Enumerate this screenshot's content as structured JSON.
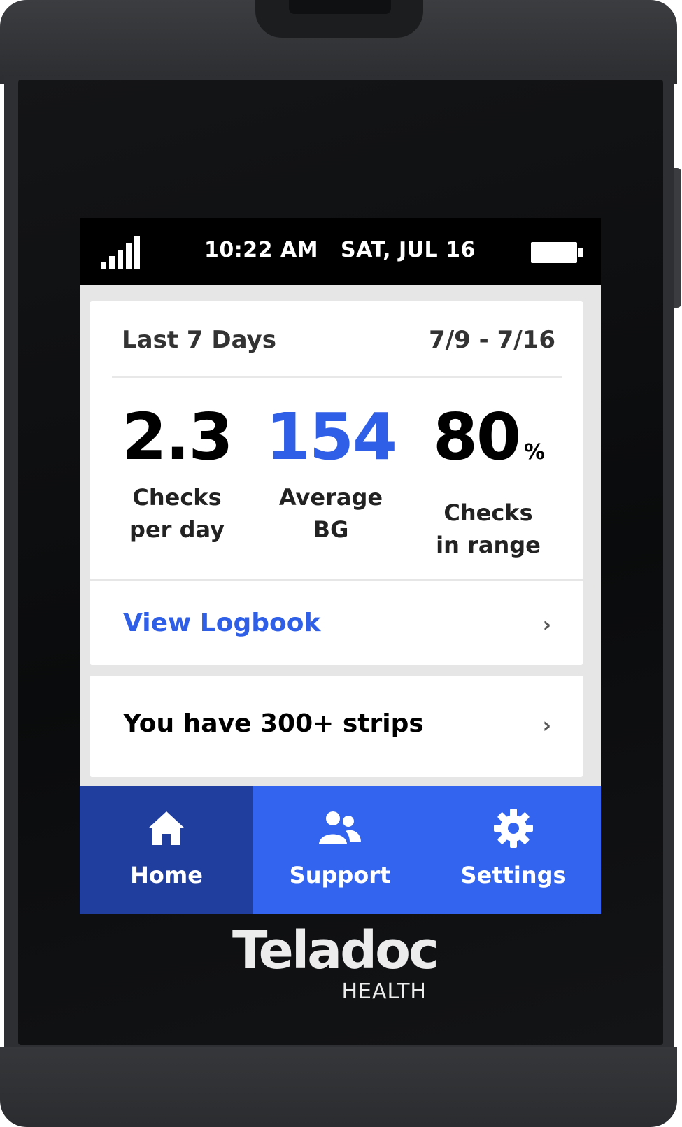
{
  "status_bar": {
    "time": "10:22 AM",
    "date": "SAT, JUL 16",
    "signal_icon": "signal-bars-icon",
    "battery_icon": "battery-full-icon"
  },
  "summary": {
    "title": "Last 7 Days",
    "range": "7/9 - 7/16",
    "stats": [
      {
        "value": "2.3",
        "unit": "",
        "label_line1": "Checks",
        "label_line2": "per day",
        "color": "#000000"
      },
      {
        "value": "154",
        "unit": "",
        "label_line1": "Average",
        "label_line2": "BG",
        "color": "#2f5fe7"
      },
      {
        "value": "80",
        "unit": "%",
        "label_line1": "Checks",
        "label_line2": "in range",
        "color": "#000000"
      }
    ]
  },
  "logbook": {
    "label": "View Logbook",
    "chevron": "›"
  },
  "strips": {
    "label": "You have 300+ strips",
    "chevron": "›"
  },
  "nav": {
    "items": [
      {
        "label": "Home",
        "icon": "home-icon",
        "active": true
      },
      {
        "label": "Support",
        "icon": "people-icon",
        "active": false
      },
      {
        "label": "Settings",
        "icon": "gear-icon",
        "active": false
      }
    ]
  },
  "brand": {
    "name": "Teladoc",
    "sub": "HEALTH"
  },
  "colors": {
    "accent_blue": "#3264f0",
    "active_nav": "#1f3e9e",
    "stat_blue": "#2f5fe7"
  }
}
